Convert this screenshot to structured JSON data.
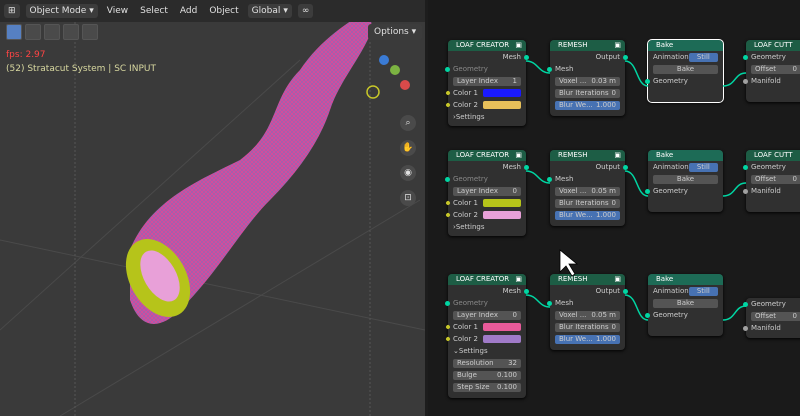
{
  "viewport": {
    "mode": "Object Mode",
    "menu": [
      "View",
      "Select",
      "Add",
      "Object"
    ],
    "transform_orientation": "Global",
    "options_label": "Options",
    "fps_text": "fps: 2.97",
    "object_info": "(52) Stratacut System | SC INPUT"
  },
  "nodes": {
    "loaf_title": "LOAF CREATOR",
    "remesh_title": "REMESH",
    "bake_title": "Bake",
    "cutter_title": "LOAF CUTT",
    "labels": {
      "mesh": "Mesh",
      "geometry": "Geometry",
      "layer_index": "Layer Index",
      "color1": "Color 1",
      "color2": "Color 2",
      "settings": "Settings",
      "output": "Output",
      "voxel": "Voxel ...",
      "blur_iter": "Blur Iterations",
      "blur_we": "Blur We...",
      "animation": "Animation",
      "still": "Still",
      "bake": "Bake",
      "offset": "Offset",
      "manifold": "Manifold",
      "resolution": "Resolution",
      "bulge": "Bulge",
      "step_size": "Step Size"
    },
    "rows": [
      {
        "layer_index": "1",
        "color1": "#1a1aff",
        "color2": "#e8c05a",
        "voxel": "0.03 m",
        "blur_iter": "0",
        "blur_we": "1.000",
        "offset": "0"
      },
      {
        "layer_index": "0",
        "color1": "#b6c41a",
        "color2": "#e8a0d8",
        "voxel": "0.05 m",
        "blur_iter": "0",
        "blur_we": "1.000",
        "offset": "0"
      },
      {
        "layer_index": "0",
        "color1": "#e85a9a",
        "color2": "#a07ac8",
        "voxel": "0.05 m",
        "blur_iter": "0",
        "blur_we": "1.000",
        "offset": "0",
        "resolution": "32",
        "bulge": "0.100",
        "step_size": "0.100"
      }
    ]
  }
}
